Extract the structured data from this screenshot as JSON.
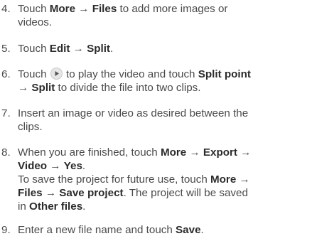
{
  "steps": [
    {
      "num": "4.",
      "lines": [
        [
          {
            "t": "Touch "
          },
          {
            "t": "More",
            "b": true
          },
          {
            "t": " → "
          },
          {
            "t": "Files",
            "b": true
          },
          {
            "t": " to add more images or"
          }
        ],
        [
          {
            "t": "videos."
          }
        ]
      ]
    },
    {
      "num": "5.",
      "lines": [
        [
          {
            "t": "Touch "
          },
          {
            "t": "Edit",
            "b": true
          },
          {
            "t": " → "
          },
          {
            "t": "Split",
            "b": true
          },
          {
            "t": "."
          }
        ]
      ]
    },
    {
      "num": "6.",
      "lines": [
        [
          {
            "t": "Touch "
          },
          {
            "icon": "play-icon"
          },
          {
            "t": " to play the video and touch "
          },
          {
            "t": "Split point",
            "b": true
          }
        ],
        [
          {
            "t": "→ "
          },
          {
            "t": "Split",
            "b": true
          },
          {
            "t": " to divide the file into two clips."
          }
        ]
      ]
    },
    {
      "num": "7.",
      "lines": [
        [
          {
            "t": "Insert an image or video as desired between the"
          }
        ],
        [
          {
            "t": "clips."
          }
        ]
      ]
    },
    {
      "num": "8.",
      "lines": [
        [
          {
            "t": "When you are finished, touch "
          },
          {
            "t": "More",
            "b": true
          },
          {
            "t": " → "
          },
          {
            "t": "Export",
            "b": true
          },
          {
            "t": " →"
          }
        ],
        [
          {
            "t": "Video",
            "b": true
          },
          {
            "t": " → "
          },
          {
            "t": "Yes",
            "b": true
          },
          {
            "t": "."
          }
        ]
      ]
    },
    {
      "num": "",
      "lines": [
        [
          {
            "t": "To save the project for future use, touch "
          },
          {
            "t": "More",
            "b": true
          },
          {
            "t": " →"
          }
        ],
        [
          {
            "t": "Files",
            "b": true
          },
          {
            "t": " → "
          },
          {
            "t": "Save project",
            "b": true
          },
          {
            "t": ". The project will be saved"
          }
        ],
        [
          {
            "t": "in "
          },
          {
            "t": "Other files",
            "b": true
          },
          {
            "t": "."
          }
        ]
      ]
    },
    {
      "num": "9.",
      "lines": [
        [
          {
            "t": "Enter a new file name and touch "
          },
          {
            "t": "Save",
            "b": true
          },
          {
            "t": "."
          }
        ]
      ]
    }
  ]
}
